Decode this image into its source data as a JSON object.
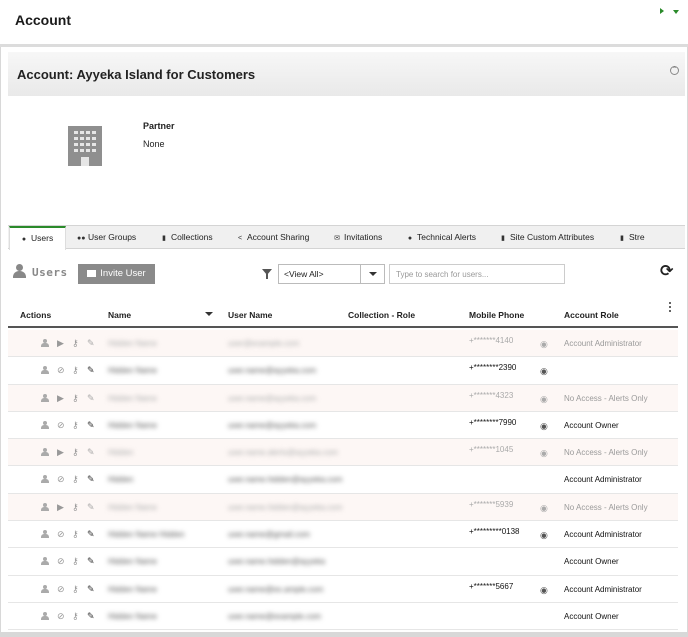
{
  "page": {
    "title": "Account"
  },
  "account": {
    "title": "Account: Ayyeka Island for Customers",
    "partner_label": "Partner",
    "partner_value": "None"
  },
  "tabs": [
    {
      "label": "Users",
      "icon": "user-icon",
      "active": true
    },
    {
      "label": "User Groups",
      "icon": "users-icon",
      "active": false
    },
    {
      "label": "Collections",
      "icon": "document-icon",
      "active": false
    },
    {
      "label": "Account Sharing",
      "icon": "share-icon",
      "active": false
    },
    {
      "label": "Invitations",
      "icon": "envelope-icon",
      "active": false
    },
    {
      "label": "Technical Alerts",
      "icon": "alert-icon",
      "active": false
    },
    {
      "label": "Site Custom Attributes",
      "icon": "document-icon",
      "active": false
    },
    {
      "label": "Stre",
      "icon": "document-icon",
      "active": false
    }
  ],
  "toolbar": {
    "section_title": "Users",
    "invite_label": "Invite User",
    "filter_value": "<View All>",
    "search_placeholder": "Type to search for users..."
  },
  "table": {
    "headers": {
      "actions": "Actions",
      "name": "Name",
      "username": "User Name",
      "collection_role": "Collection - Role",
      "mobile_phone": "Mobile Phone",
      "account_role": "Account Role"
    },
    "rows": [
      {
        "inactive": true,
        "name": "Hidden Name",
        "username": "user@example.com",
        "phone": "+*******4140",
        "eye": true,
        "role": "Account Administrator"
      },
      {
        "inactive": false,
        "name": "Hidden Name",
        "username": "user.name@ayyeka.com",
        "phone": "+********2390",
        "eye": true,
        "role": ""
      },
      {
        "inactive": true,
        "name": "Hidden Name",
        "username": "user.name@ayyeka.com",
        "phone": "+*******4323",
        "eye": true,
        "role": "No Access - Alerts Only"
      },
      {
        "inactive": false,
        "name": "Hidden Name",
        "username": "user.name@ayyeka.com",
        "phone": "+********7990",
        "eye": true,
        "role": "Account Owner"
      },
      {
        "inactive": true,
        "name": "Hidden",
        "username": "user.name.alerts@ayyeka.com",
        "phone": "+*******1045",
        "eye": true,
        "role": "No Access - Alerts Only"
      },
      {
        "inactive": false,
        "name": "Hidden",
        "username": "user.name.hidden@ayyeka.com",
        "phone": "",
        "eye": false,
        "role": "Account Administrator"
      },
      {
        "inactive": true,
        "name": "Hidden Name",
        "username": "user.name.hidden@ayyeka.com",
        "phone": "+*******5939",
        "eye": true,
        "role": "No Access - Alerts Only"
      },
      {
        "inactive": false,
        "name": "Hidden Name Hidden",
        "username": "user.name@gmail.com",
        "phone": "+*********0138",
        "eye": true,
        "role": "Account Administrator"
      },
      {
        "inactive": false,
        "name": "Hidden Name",
        "username": "user.name.hidden@ayyeka",
        "phone": "",
        "eye": false,
        "role": "Account Owner"
      },
      {
        "inactive": false,
        "name": "Hidden Name",
        "username": "user.name@ex.ample.com",
        "phone": "+*******5667",
        "eye": true,
        "role": "Account Administrator"
      },
      {
        "inactive": false,
        "name": "Hidden Name",
        "username": "user.name@example.com",
        "phone": "",
        "eye": false,
        "role": "Account Owner"
      }
    ]
  },
  "colors": {
    "accent": "#2a8a2a",
    "button_gray": "#8a8a8a",
    "inactive_row": "#fdf7f5"
  }
}
